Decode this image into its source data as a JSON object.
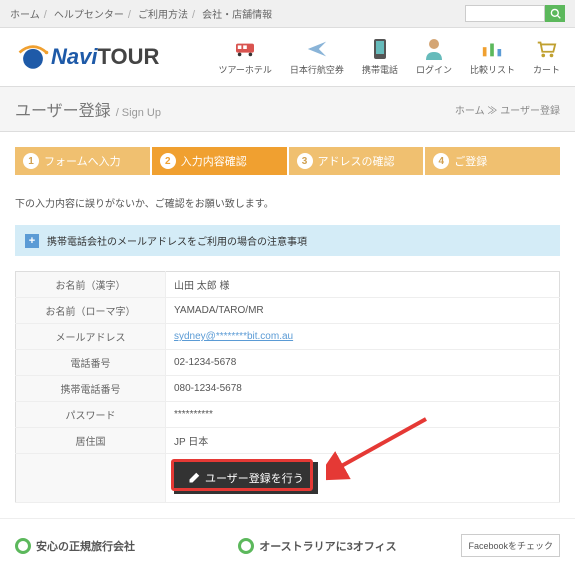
{
  "topbar": {
    "links": [
      "ホーム",
      "ヘルプセンター",
      "ご利用方法",
      "会社・店舗情報"
    ]
  },
  "nav": [
    {
      "label": "ツアーホテル"
    },
    {
      "label": "日本行航空券"
    },
    {
      "label": "携帯電話"
    },
    {
      "label": "ログイン"
    },
    {
      "label": "比較リスト"
    },
    {
      "label": "カート"
    }
  ],
  "logo": {
    "navi": "Navi",
    "tour": "TOUR"
  },
  "pageTitle": {
    "main": "ユーザー登録",
    "sub": "/ Sign Up"
  },
  "breadcrumb": {
    "home": "ホーム",
    "sep": " ≫ ",
    "current": "ユーザー登録"
  },
  "steps": [
    {
      "num": "1",
      "label": "フォームへ入力"
    },
    {
      "num": "2",
      "label": "入力内容確認"
    },
    {
      "num": "3",
      "label": "アドレスの確認"
    },
    {
      "num": "4",
      "label": "ご登録"
    }
  ],
  "instruction": "下の入力内容に誤りがないか、ご確認をお願い致します。",
  "infoBox": "携帯電話会社のメールアドレスをご利用の場合の注意事項",
  "form": {
    "rows": [
      {
        "label": "お名前（漢字）",
        "value": "山田 太郎 様"
      },
      {
        "label": "お名前（ローマ字）",
        "value": "YAMADA/TARO/MR"
      },
      {
        "label": "メールアドレス",
        "value": "sydney@********bit.com.au",
        "isEmail": true
      },
      {
        "label": "電話番号",
        "value": "02-1234-5678"
      },
      {
        "label": "携帯電話番号",
        "value": "080-1234-5678"
      },
      {
        "label": "パスワード",
        "value": "**********"
      },
      {
        "label": "居住国",
        "value": "JP 日本"
      }
    ],
    "submit": "ユーザー登録を行う"
  },
  "footer": {
    "col1": "安心の正規旅行会社",
    "col2": "オーストラリアに3オフィス",
    "fb": "Facebookをチェック"
  }
}
